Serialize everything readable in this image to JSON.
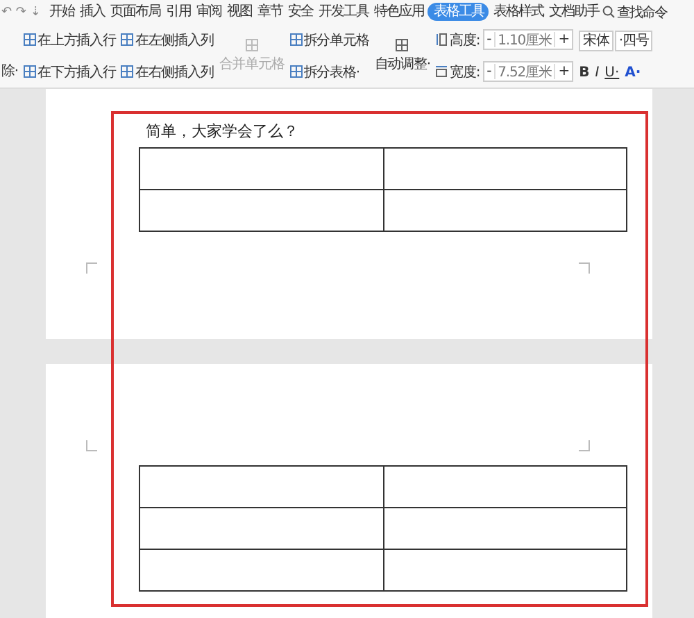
{
  "quick_access": [
    "↶",
    "↷",
    "⇣"
  ],
  "menu_tabs": [
    {
      "label": "开始",
      "selected": false
    },
    {
      "label": "插入",
      "selected": false
    },
    {
      "label": "页面布局",
      "selected": false
    },
    {
      "label": "引用",
      "selected": false
    },
    {
      "label": "审阅",
      "selected": false
    },
    {
      "label": "视图",
      "selected": false
    },
    {
      "label": "章节",
      "selected": false
    },
    {
      "label": "安全",
      "selected": false
    },
    {
      "label": "开发工具",
      "selected": false
    },
    {
      "label": "特色应用",
      "selected": false
    },
    {
      "label": "表格工具",
      "selected": true
    },
    {
      "label": "表格样式",
      "selected": false
    },
    {
      "label": "文档助手",
      "selected": false
    }
  ],
  "search": {
    "label": "查找命令"
  },
  "ribbon": {
    "delete_menu": "除·",
    "insert_rows": [
      "在上方插入行",
      "在下方插入行"
    ],
    "insert_cols": [
      "在左侧插入列",
      "在右侧插入列"
    ],
    "merge": {
      "label": "合并单元格",
      "disabled": true
    },
    "split": [
      "拆分单元格",
      "拆分表格·"
    ],
    "autofit": "自动调整·",
    "sizes": [
      {
        "kind": "height",
        "label": "高度:",
        "minus": "-",
        "value": "1.10厘米",
        "plus": "+"
      },
      {
        "kind": "width",
        "label": "宽度:",
        "minus": "-",
        "value": "7.52厘米",
        "plus": "+"
      }
    ],
    "font": "宋体",
    "font_size": "·四号",
    "format_buttons": [
      "B",
      "I",
      "U·",
      "A·"
    ]
  },
  "page_text": "简单，大家学会了么？"
}
